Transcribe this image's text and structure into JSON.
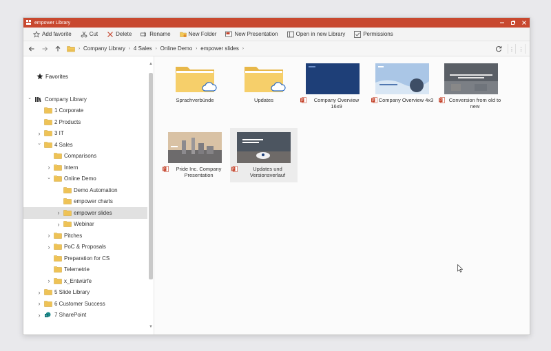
{
  "window": {
    "title": "empower Library"
  },
  "toolbar": {
    "add_favorite": "Add favorite",
    "cut": "Cut",
    "delete": "Delete",
    "rename": "Rename",
    "new_folder": "New Folder",
    "new_presentation": "New Presentation",
    "open_new_library": "Open in new Library",
    "permissions": "Permissions"
  },
  "breadcrumb": [
    "Company Library",
    "4 Sales",
    "Online Demo",
    "empower slides"
  ],
  "sidebar": {
    "favorites": "Favorites",
    "tree": [
      {
        "label": "Company Library",
        "level": 0,
        "expand": "open",
        "icon": "library"
      },
      {
        "label": "1 Corporate",
        "level": 1,
        "expand": "none",
        "icon": "folder"
      },
      {
        "label": "2 Products",
        "level": 1,
        "expand": "none",
        "icon": "folder"
      },
      {
        "label": "3 IT",
        "level": 1,
        "expand": "closed",
        "icon": "folder"
      },
      {
        "label": "4 Sales",
        "level": 1,
        "expand": "open",
        "icon": "folder"
      },
      {
        "label": "Comparisons",
        "level": 2,
        "expand": "none",
        "icon": "folder"
      },
      {
        "label": "Intern",
        "level": 2,
        "expand": "closed",
        "icon": "folder"
      },
      {
        "label": "Online Demo",
        "level": 2,
        "expand": "open",
        "icon": "folder"
      },
      {
        "label": "Demo Automation",
        "level": 3,
        "expand": "none",
        "icon": "folder"
      },
      {
        "label": "empower charts",
        "level": 3,
        "expand": "none",
        "icon": "folder"
      },
      {
        "label": "empower slides",
        "level": 3,
        "expand": "closed",
        "icon": "folder",
        "selected": true
      },
      {
        "label": "Webinar",
        "level": 3,
        "expand": "closed",
        "icon": "folder"
      },
      {
        "label": "Pitches",
        "level": 2,
        "expand": "closed",
        "icon": "folder"
      },
      {
        "label": "PoC & Proposals",
        "level": 2,
        "expand": "closed",
        "icon": "folder"
      },
      {
        "label": "Preparation for CS",
        "level": 2,
        "expand": "none",
        "icon": "folder"
      },
      {
        "label": "Telemetrie",
        "level": 2,
        "expand": "none",
        "icon": "folder"
      },
      {
        "label": "x_Entwürfe",
        "level": 2,
        "expand": "closed",
        "icon": "folder"
      },
      {
        "label": "5 Slide Library",
        "level": 1,
        "expand": "closed",
        "icon": "folder"
      },
      {
        "label": "6 Customer Success",
        "level": 1,
        "expand": "closed",
        "icon": "folder"
      },
      {
        "label": "7 SharePoint",
        "level": 1,
        "expand": "closed",
        "icon": "sharepoint"
      }
    ]
  },
  "items": [
    {
      "label": "Sprachverbünde",
      "type": "folder"
    },
    {
      "label": "Updates",
      "type": "folder"
    },
    {
      "label": "Company Overview 16x9",
      "type": "ppt",
      "thumb": "blue"
    },
    {
      "label": "Company Overview 4x3",
      "type": "ppt",
      "thumb": "light"
    },
    {
      "label": "Conversion from old to new",
      "type": "ppt",
      "thumb": "office"
    },
    {
      "label": "Pride Inc. Company Presentation",
      "type": "ppt",
      "thumb": "city"
    },
    {
      "label": "Updates und Versionsverlauf",
      "type": "ppt",
      "thumb": "laptop"
    }
  ],
  "colors": {
    "titlebar": "#c8482f",
    "folder": "#f3c95a",
    "ppt_red": "#c4432b",
    "selected_row": "#e1e1e1"
  }
}
